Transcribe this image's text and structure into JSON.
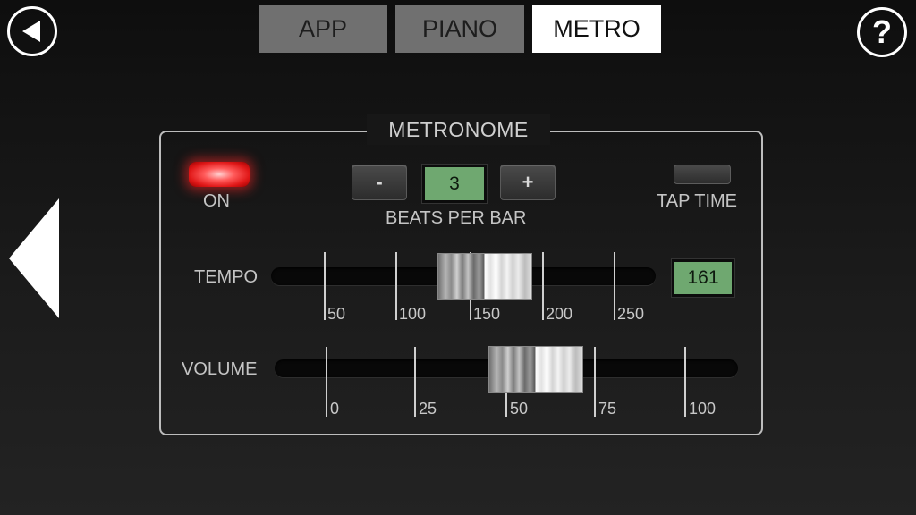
{
  "header": {
    "back_icon": "back-arrow-icon",
    "help_label": "?",
    "tabs": [
      {
        "label": "APP",
        "active": false
      },
      {
        "label": "PIANO",
        "active": false
      },
      {
        "label": "METRO",
        "active": true
      }
    ]
  },
  "panel": {
    "title": "METRONOME",
    "on_label": "ON",
    "on_state": true,
    "beats": {
      "minus_label": "-",
      "plus_label": "+",
      "value": "3",
      "label": "BEATS PER BAR"
    },
    "tap_label": "TAP TIME",
    "tempo": {
      "label": "TEMPO",
      "value": "161",
      "ticks": [
        "50",
        "100",
        "150",
        "200",
        "250"
      ],
      "slider_value": 161
    },
    "volume": {
      "label": "VOLUME",
      "ticks": [
        "0",
        "25",
        "50",
        "75",
        "100"
      ],
      "slider_value": 48
    }
  },
  "nav": {
    "prev_icon": "previous-page-arrow-icon"
  },
  "colors": {
    "lcd": "#6fa870",
    "led": "#ff3030",
    "active_tab": "#ffffff",
    "inactive_tab": "#707070"
  }
}
